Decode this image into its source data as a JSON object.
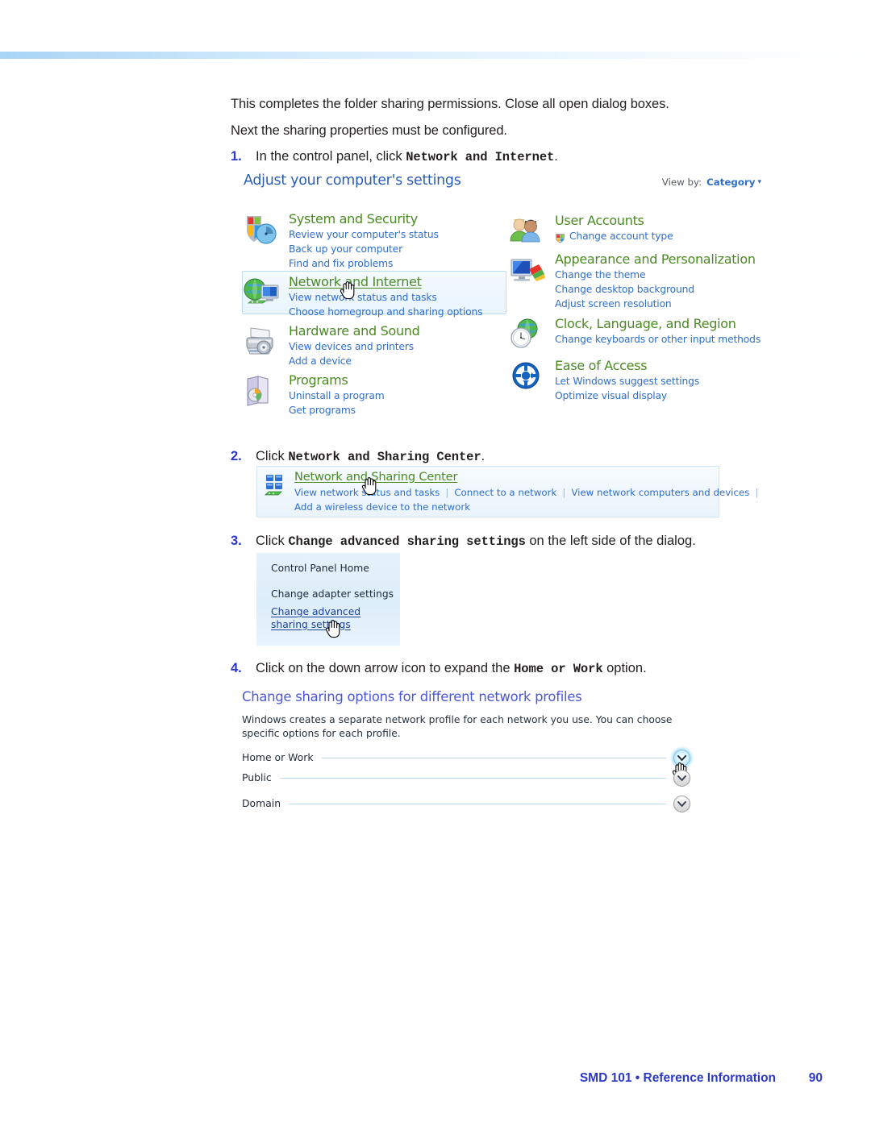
{
  "document": {
    "intro_lines": [
      "This completes the folder sharing permissions. Close all open dialog boxes.",
      "Next the sharing properties must be configured."
    ],
    "steps": [
      {
        "num": "1.",
        "pre": "In the control panel, click ",
        "mono": "Network and Internet",
        "post": "."
      },
      {
        "num": "2.",
        "pre": "Click ",
        "mono": "Network and Sharing Center",
        "post": "."
      },
      {
        "num": "3.",
        "pre": "Click ",
        "mono": "Change advanced sharing settings",
        "post": " on the left side of the dialog."
      },
      {
        "num": "4.",
        "pre": "Click on the down arrow icon to expand the ",
        "mono": "Home or Work",
        "post": " option."
      }
    ]
  },
  "control_panel": {
    "title": "Adjust your computer's settings",
    "view_by_label": "View by:",
    "view_by_value": "Category",
    "view_by_caret": "▾",
    "categories_left": [
      {
        "icon": "shield-and-clock-icon",
        "heading": "System and Security",
        "links": [
          "Review your computer's status",
          "Back up your computer",
          "Find and fix problems"
        ]
      },
      {
        "icon": "globe-and-monitor-icon",
        "heading": "Network and Internet",
        "links": [
          "View network status and tasks",
          "Choose homegroup and sharing options"
        ]
      },
      {
        "icon": "printer-icon",
        "heading": "Hardware and Sound",
        "links": [
          "View devices and printers",
          "Add a device"
        ]
      },
      {
        "icon": "program-box-icon",
        "heading": "Programs",
        "links": [
          "Uninstall a program",
          "Get programs"
        ]
      }
    ],
    "categories_right": [
      {
        "icon": "users-icon",
        "heading": "User Accounts",
        "links": [
          "Change account type"
        ]
      },
      {
        "icon": "monitor-palette-icon",
        "heading": "Appearance and Personalization",
        "links": [
          "Change the theme",
          "Change desktop background",
          "Adjust screen resolution"
        ]
      },
      {
        "icon": "clock-globe-icon",
        "heading": "Clock, Language, and Region",
        "links": [
          "Change keyboards or other input methods"
        ]
      },
      {
        "icon": "ease-of-access-icon",
        "heading": "Ease of Access",
        "links": [
          "Let Windows suggest settings",
          "Optimize visual display"
        ]
      }
    ]
  },
  "network_sharing_center": {
    "icon": "network-tiles-icon",
    "heading": "Network and Sharing Center",
    "row1": [
      "View network status and tasks",
      "Connect to a network",
      "View network computers and devices"
    ],
    "row2": [
      "Add a wireless device to the network"
    ],
    "separator": "|"
  },
  "control_panel_sidebar": {
    "items": [
      "Control Panel Home",
      "Change adapter settings"
    ],
    "active_link": "Change advanced sharing settings"
  },
  "advanced_sharing": {
    "title": "Change sharing options for different network profiles",
    "description": "Windows creates a separate network profile for each network you use. You can choose specific options for each profile.",
    "profiles": [
      {
        "label": "Home or Work",
        "state": "collapsed",
        "highlighted": true
      },
      {
        "label": "Public",
        "state": "collapsed",
        "highlighted": false
      },
      {
        "label": "Domain",
        "state": "collapsed",
        "highlighted": false
      }
    ],
    "chevron_icon": "chevron-down-icon"
  },
  "footer": {
    "title": "SMD 101 • Reference Information",
    "page_number": "90"
  },
  "colors": {
    "step_number": "#2b38c8",
    "footer": "#2b38c8",
    "cp_title": "#2b5fb4",
    "category_heading": "#4b8a23",
    "category_link": "#2f6ecb",
    "adv_title": "#4b58d4",
    "body_text": "#231f20"
  }
}
